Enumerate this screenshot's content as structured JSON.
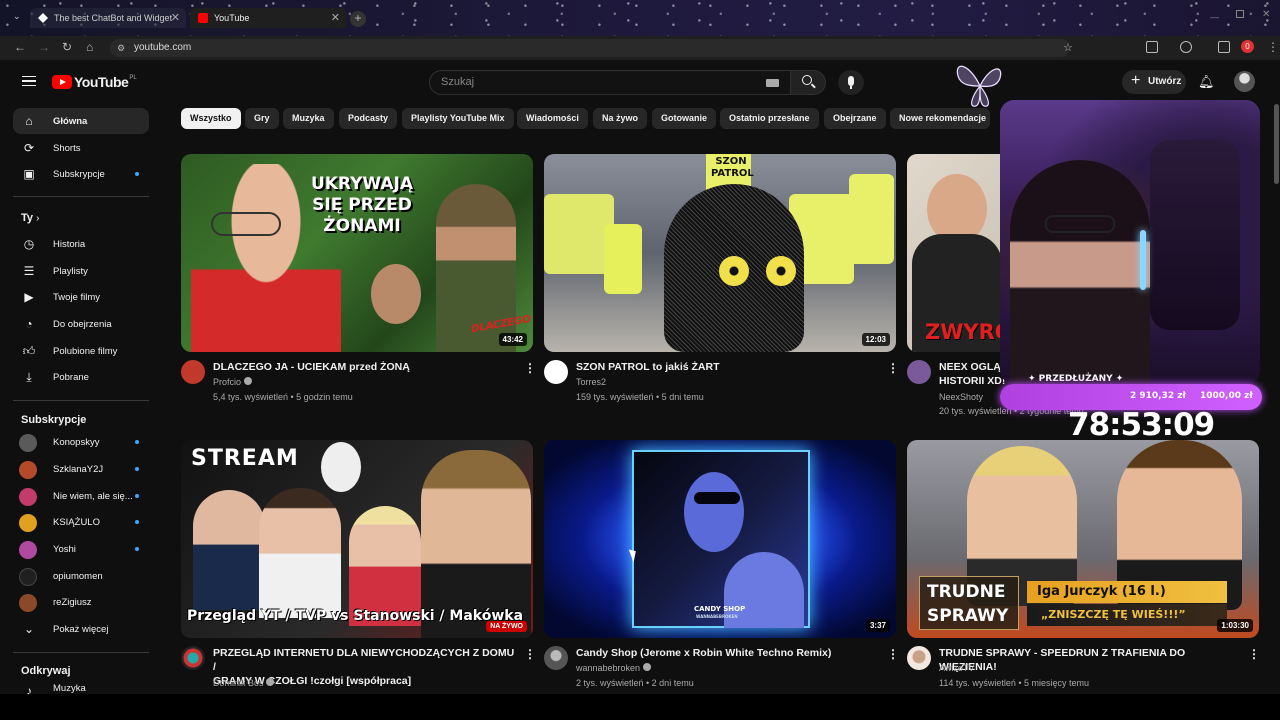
{
  "browser": {
    "tabs": [
      {
        "title": "The best ChatBot and Widgets"
      },
      {
        "title": "YouTube"
      }
    ],
    "url": "youtube.com",
    "ext_badge": "0"
  },
  "header": {
    "logo_text": "YouTube",
    "logo_country": "PL",
    "search_placeholder": "Szukaj",
    "create_label": "Utwórz"
  },
  "sidebar": {
    "main": [
      {
        "label": "Główna",
        "icon": "home-icon"
      },
      {
        "label": "Shorts",
        "icon": "shorts-icon"
      },
      {
        "label": "Subskrypcje",
        "icon": "subscriptions-icon"
      }
    ],
    "you_heading": "Ty",
    "you": [
      {
        "label": "Historia",
        "icon": "history-icon"
      },
      {
        "label": "Playlisty",
        "icon": "playlists-icon"
      },
      {
        "label": "Twoje filmy",
        "icon": "your-videos-icon"
      },
      {
        "label": "Do obejrzenia",
        "icon": "watch-later-icon"
      },
      {
        "label": "Polubione filmy",
        "icon": "liked-icon"
      },
      {
        "label": "Pobrane",
        "icon": "download-icon"
      }
    ],
    "subs_heading": "Subskrypcje",
    "subs": [
      {
        "label": "Konopskyy",
        "color": "#5a5a5a"
      },
      {
        "label": "SzklanaY2J",
        "color": "#b34a2a"
      },
      {
        "label": "Nie wiem, ale się...",
        "color": "#c23b6a"
      },
      {
        "label": "KSIĄŻULO",
        "color": "#e0a020"
      },
      {
        "label": "Yoshi",
        "color": "#b04aa0"
      },
      {
        "label": "opiumomen",
        "color": "#202020"
      },
      {
        "label": "reZigiusz",
        "color": "#8a4a2a"
      }
    ],
    "show_more": "Pokaż więcej",
    "explore_heading": "Odkrywaj",
    "explore_first": "Muzyka"
  },
  "chips": [
    "Wszystko",
    "Gry",
    "Muzyka",
    "Podcasty",
    "Playlisty YouTube Mix",
    "Wiadomości",
    "Na żywo",
    "Gotowanie",
    "Ostatnio przesłane",
    "Obejrzane",
    "Nowe rekomendacje"
  ],
  "videos": [
    {
      "title": "DLACZEGO JA - UCIEKAM przed ŻONĄ",
      "title2": "",
      "channel": "Profcio",
      "meta": "5,4 tys. wyświetleń • 5 godzin temu",
      "duration": "43:42",
      "thumb_text": "UKRYWAJĄ SIĘ PRZED ŻONAMI",
      "thumb_sub": "DLACZEGO"
    },
    {
      "title": "SZON PATROL to jakiś ŻART",
      "title2": "",
      "channel": "Torres2",
      "meta": "159 tys. wyświetleń • 5 dni temu",
      "duration": "12:03",
      "thumb_text": "SZON PATROL"
    },
    {
      "title": "NEEX OGLĄD...",
      "title2": "HISTORII XD!",
      "channel": "NeexShoty",
      "meta": "20 tys. wyświetleń • 2 tygodnie temu",
      "duration": "",
      "thumb_text": "ZWYRO"
    },
    {
      "title": "PRZEGLĄD INTERNETU DLA NIEWYCHODZĄCYCH Z DOMU /",
      "title2": "GRAMY W CZOŁGI !czołgi [współpraca]",
      "channel": "Dominik Bos",
      "meta": "",
      "duration": "NA ŻYWO",
      "thumb_text": "STREAM",
      "thumb_sub": "Przegląd YT / TVP vs Stanowski / Makówka / Czołgi"
    },
    {
      "title": "Candy Shop (Jerome x Robin White Techno Remix)",
      "title2": "",
      "channel": "wannabebroken",
      "meta": "2 tys. wyświetleń • 2 dni temu",
      "duration": "3:37",
      "thumb_text": "CANDY SHOP",
      "thumb_sub": "WANNABEBROKEN"
    },
    {
      "title": "TRUDNE SPRAWY - SPEEDRUN Z TRAFIENIA DO WIĘZIENIA!",
      "title2": "",
      "channel": "AwizoTV",
      "meta": "114 tys. wyświetleń • 5 miesięcy temu",
      "duration": "1:03:30",
      "thumb_text": "TRUDNE SPRAWY",
      "thumb_name": "Iga Jurczyk (16 l.)",
      "thumb_quote": "„ZNISZCZĘ TĘ WIEŚ!!!”"
    }
  ],
  "overlay": {
    "extended_label": "✦ PRZEDŁUŻANY ✦",
    "amount_1": "2 910,32 zł",
    "amount_2": "1000,00 zł",
    "timer": "78:53:09"
  }
}
